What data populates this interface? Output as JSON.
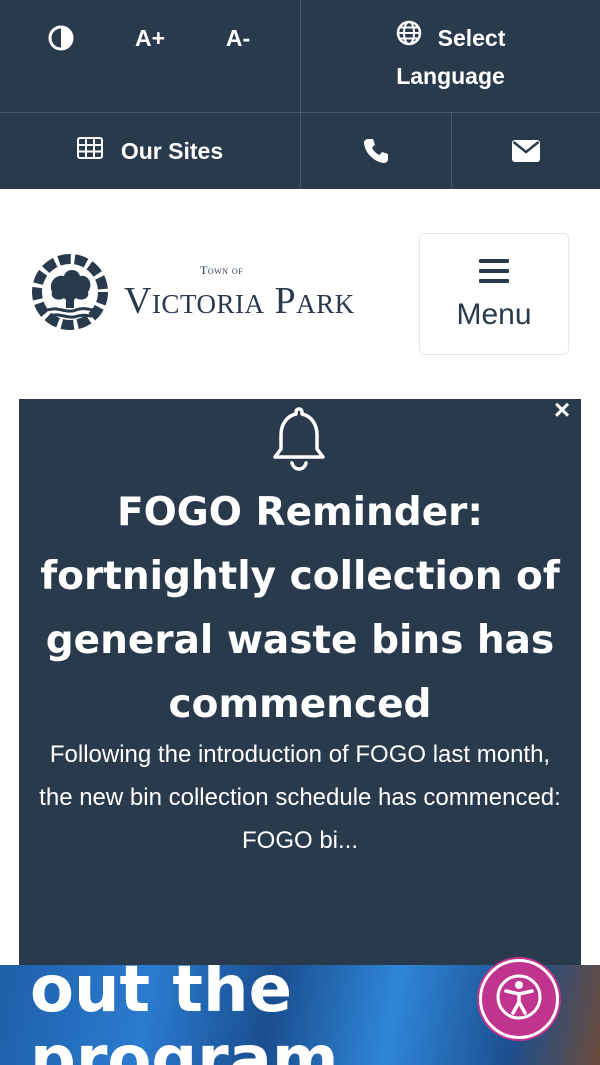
{
  "topbar": {
    "contrast_icon": "contrast-icon",
    "font_increase_label": "A+",
    "font_decrease_label": "A-",
    "language_line1": "Select",
    "language_line2": "Language",
    "language_icon": "globe-icon",
    "our_sites_label": "Our Sites",
    "our_sites_icon": "grid-icon",
    "phone_icon": "phone-icon",
    "email_icon": "envelope-icon"
  },
  "header": {
    "logo_small": "Town of",
    "logo_big": "Victoria Park",
    "menu_label": "Menu",
    "menu_icon": "hamburger-icon"
  },
  "modal": {
    "close_label": "×",
    "icon": "bell-icon",
    "title": "FOGO Reminder: fortnightly collection of general waste bins has commenced",
    "body": "Following the introduction of FOGO last month, the new bin collection schedule has commenced: FOGO bi..."
  },
  "hero": {
    "text": "out the program"
  },
  "accessibility": {
    "icon": "accessibility-icon"
  },
  "colors": {
    "navy": "#2a3a4d",
    "accent_magenta": "#c0338f"
  }
}
